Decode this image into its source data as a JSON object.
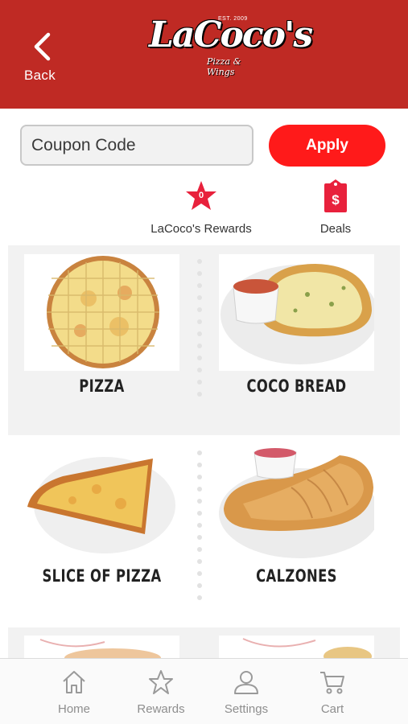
{
  "header": {
    "back_label": "Back",
    "logo_text": "LaCoco's",
    "logo_est": "EST. 2009",
    "logo_tagline": "Pizza & Wings",
    "color": "#bf2a24"
  },
  "coupon": {
    "placeholder": "Coupon Code",
    "value": "",
    "apply_label": "Apply",
    "apply_color": "#ff1a1a"
  },
  "quick_links": {
    "rewards": {
      "label": "LaCoco's Rewards",
      "count": "0",
      "icon": "star-badge-icon"
    },
    "deals": {
      "label": "Deals",
      "icon": "price-tag-icon"
    }
  },
  "menu": {
    "items": [
      {
        "label": "PIZZA",
        "icon": "pizza-photo"
      },
      {
        "label": "COCO BREAD",
        "icon": "coco-bread-photo"
      },
      {
        "label": "SLICE OF PIZZA",
        "icon": "pizza-slice-photo"
      },
      {
        "label": "CALZONES",
        "icon": "calzone-photo"
      }
    ]
  },
  "tabbar": {
    "tabs": [
      {
        "label": "Home",
        "icon": "home-icon"
      },
      {
        "label": "Rewards",
        "icon": "star-icon"
      },
      {
        "label": "Settings",
        "icon": "person-icon"
      },
      {
        "label": "Cart",
        "icon": "cart-icon"
      }
    ]
  }
}
